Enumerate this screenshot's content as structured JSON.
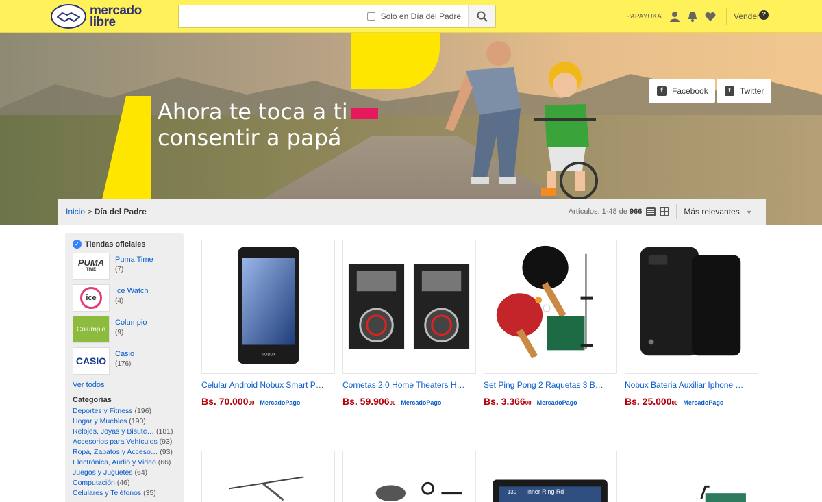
{
  "header": {
    "logo_top": "mercado",
    "logo_bottom": "libre",
    "search_placeholder": "",
    "search_checkbox_label": "Solo en Día del Padre",
    "username": "PAPAYUKA",
    "sell_label": "Vender",
    "help_icon": "?"
  },
  "banner": {
    "headline_line1": "Ahora te toca a ti",
    "headline_line2": "consentir a papá",
    "facebook_label": "Facebook",
    "twitter_label": "Twitter"
  },
  "breadcrumb": {
    "home": "Inicio",
    "separator": ">",
    "current": "Día del Padre",
    "count_prefix": "Artículos: 1-48 de",
    "count_total": "966",
    "sort_label": "Más relevantes"
  },
  "sidebar": {
    "official_title": "Tiendas oficiales",
    "stores": [
      {
        "name": "Puma Time",
        "count": "(7)",
        "logo": "PUMA",
        "logo_sub": "TIME"
      },
      {
        "name": "Ice Watch",
        "count": "(4)",
        "logo": "ice"
      },
      {
        "name": "Columpio",
        "count": "(9)",
        "logo": "Columpio"
      },
      {
        "name": "Casio",
        "count": "(176)",
        "logo": "CASIO"
      }
    ],
    "see_all": "Ver todos",
    "categories_title": "Categorías",
    "categories": [
      {
        "name": "Deportes y Fitness",
        "count": "(196)"
      },
      {
        "name": "Hogar y Muebles",
        "count": "(190)"
      },
      {
        "name": "Relojes, Joyas y Bisute…",
        "count": "(181)"
      },
      {
        "name": "Accesorios para Vehículos",
        "count": "(93)"
      },
      {
        "name": "Ropa, Zapatos y Acceso…",
        "count": "(93)"
      },
      {
        "name": "Electrónica, Audio y Video",
        "count": "(66)"
      },
      {
        "name": "Juegos y Juguetes",
        "count": "(64)"
      },
      {
        "name": "Computación",
        "count": "(46)"
      },
      {
        "name": "Celulares y Teléfonos",
        "count": "(35)"
      }
    ]
  },
  "products": [
    {
      "title": "Celular Android Nobux Smart P…",
      "price": "Bs. 70.000",
      "cents": "00",
      "badge": "MercadoPago"
    },
    {
      "title": "Cornetas 2.0 Home Theaters H…",
      "price": "Bs. 59.906",
      "cents": "00",
      "badge": "MercadoPago"
    },
    {
      "title": "Set Ping Pong 2 Raquetas 3 B…",
      "price": "Bs. 3.366",
      "cents": "00",
      "badge": "MercadoPago"
    },
    {
      "title": "Nobux Bateria Auxiliar Iphone …",
      "price": "Bs. 25.000",
      "cents": "00",
      "badge": "MercadoPago"
    }
  ],
  "product_image_text": {
    "phone_brand": "NOBUX",
    "gps_street": "Inner Ring Rd",
    "gps_number": "130"
  },
  "colors": {
    "header_bg": "#fff159",
    "price": "#b3020e",
    "link": "#0b5ecb",
    "banner_yellow": "#ffe600",
    "banner_pink": "#e6185e"
  }
}
